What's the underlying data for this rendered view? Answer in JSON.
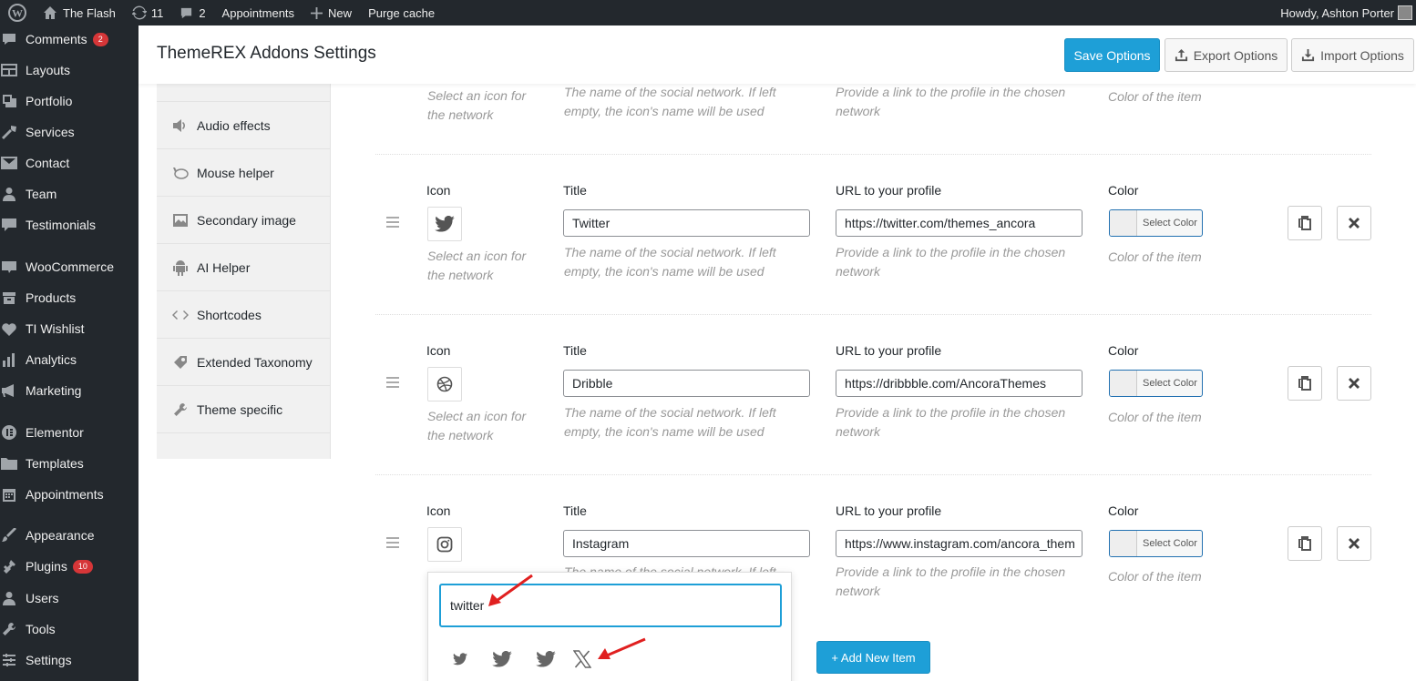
{
  "adminbar": {
    "site_name": "The Flash",
    "updates_count": "11",
    "comments_count": "2",
    "appointments": "Appointments",
    "new": "New",
    "purge": "Purge cache",
    "howdy": "Howdy, Ashton Porter"
  },
  "sidebar": {
    "items": [
      {
        "label": "Comments",
        "badge": "2",
        "icon": "comment-icon"
      },
      {
        "label": "Layouts",
        "icon": "layouts-icon"
      },
      {
        "label": "Portfolio",
        "icon": "portfolio-icon"
      },
      {
        "label": "Services",
        "icon": "services-icon"
      },
      {
        "label": "Contact",
        "icon": "mail-icon"
      },
      {
        "label": "Team",
        "icon": "user-icon"
      },
      {
        "label": "Testimonials",
        "icon": "testimonials-icon"
      },
      {
        "label": "WooCommerce",
        "icon": "woo-icon"
      },
      {
        "label": "Products",
        "icon": "products-icon"
      },
      {
        "label": "TI Wishlist",
        "icon": "heart-icon"
      },
      {
        "label": "Analytics",
        "icon": "analytics-icon"
      },
      {
        "label": "Marketing",
        "icon": "megaphone-icon"
      },
      {
        "label": "Elementor",
        "icon": "elementor-icon"
      },
      {
        "label": "Templates",
        "icon": "folder-icon"
      },
      {
        "label": "Appointments",
        "icon": "calendar-icon"
      },
      {
        "label": "Appearance",
        "icon": "brush-icon"
      },
      {
        "label": "Plugins",
        "badge": "10",
        "icon": "plugin-icon"
      },
      {
        "label": "Users",
        "icon": "users-icon"
      },
      {
        "label": "Tools",
        "icon": "wrench-icon"
      },
      {
        "label": "Settings",
        "icon": "settings-icon"
      }
    ]
  },
  "header": {
    "title": "ThemeREX Addons Settings",
    "save": "Save Options",
    "export": "Export Options",
    "import": "Import Options"
  },
  "tabs": [
    {
      "label": "Audio effects",
      "icon": "speaker-icon"
    },
    {
      "label": "Mouse helper",
      "icon": "mouse-icon"
    },
    {
      "label": "Secondary image",
      "icon": "image-icon"
    },
    {
      "label": "AI Helper",
      "icon": "android-icon"
    },
    {
      "label": "Shortcodes",
      "icon": "code-icon"
    },
    {
      "label": "Extended Taxonomy",
      "icon": "tag-icon"
    },
    {
      "label": "Theme specific",
      "icon": "wrench-icon"
    }
  ],
  "labels": {
    "icon": "Icon",
    "title": "Title",
    "url": "URL to your profile",
    "color": "Color",
    "icon_desc": "Select an icon for the network",
    "title_desc": "The name of the social network. If left empty, the icon's name will be used",
    "url_desc": "Provide a link to the profile in the chosen network",
    "color_desc": "Color of the item",
    "select_color": "Select Color"
  },
  "partial_top": {
    "icon_desc": "Select an icon for the network",
    "title_desc": "The name of the social network. If left empty, the icon's name will be used",
    "url_desc": "Provide a link to the profile in the chosen network",
    "color_desc": "Color of the item"
  },
  "rows": [
    {
      "icon": "twitter-bird-icon",
      "title": "Twitter",
      "url": "https://twitter.com/themes_ancora"
    },
    {
      "icon": "dribbble-icon",
      "title": "Dribble",
      "url": "https://dribbble.com/AncoraThemes"
    },
    {
      "icon": "instagram-icon",
      "title": "Instagram",
      "url": "https://www.instagram.com/ancora_them"
    }
  ],
  "picker": {
    "search_value": "twitter",
    "hidden_desc": "The name of the social network. If left",
    "results": [
      "twitter-small-icon",
      "twitter-icon",
      "twitter-alt-icon",
      "x-icon"
    ]
  },
  "add_new": "+ Add New Item",
  "colors": {
    "accent": "#1e9fd7",
    "admin_bg": "#23282d",
    "badge": "#d63638",
    "arrow": "#e02020"
  }
}
